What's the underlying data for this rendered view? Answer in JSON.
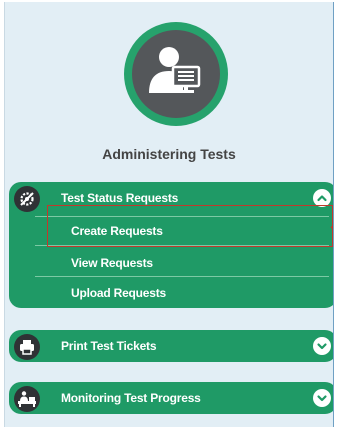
{
  "section": {
    "title": "Administering Tests",
    "avatar_icon": "user-with-monitor-icon"
  },
  "menus": [
    {
      "label": "Test Status Requests",
      "icon": "gear-slash-icon",
      "state": "expanded",
      "chevron": "chevron-up-icon",
      "items": [
        {
          "label": "Create Requests",
          "highlighted": true
        },
        {
          "label": "View Requests"
        },
        {
          "label": "Upload Requests"
        }
      ]
    },
    {
      "label": "Print Test Tickets",
      "icon": "printer-icon",
      "state": "collapsed",
      "chevron": "chevron-down-icon"
    },
    {
      "label": "Monitoring Test Progress",
      "icon": "monitoring-icon",
      "state": "collapsed",
      "chevron": "chevron-down-icon"
    }
  ],
  "colors": {
    "panel_bg": "#e2eef5",
    "menu_green": "#1f9a66",
    "avatar_ring": "#26a26c",
    "avatar_fill": "#54575a",
    "highlight_red": "#c0392b"
  }
}
